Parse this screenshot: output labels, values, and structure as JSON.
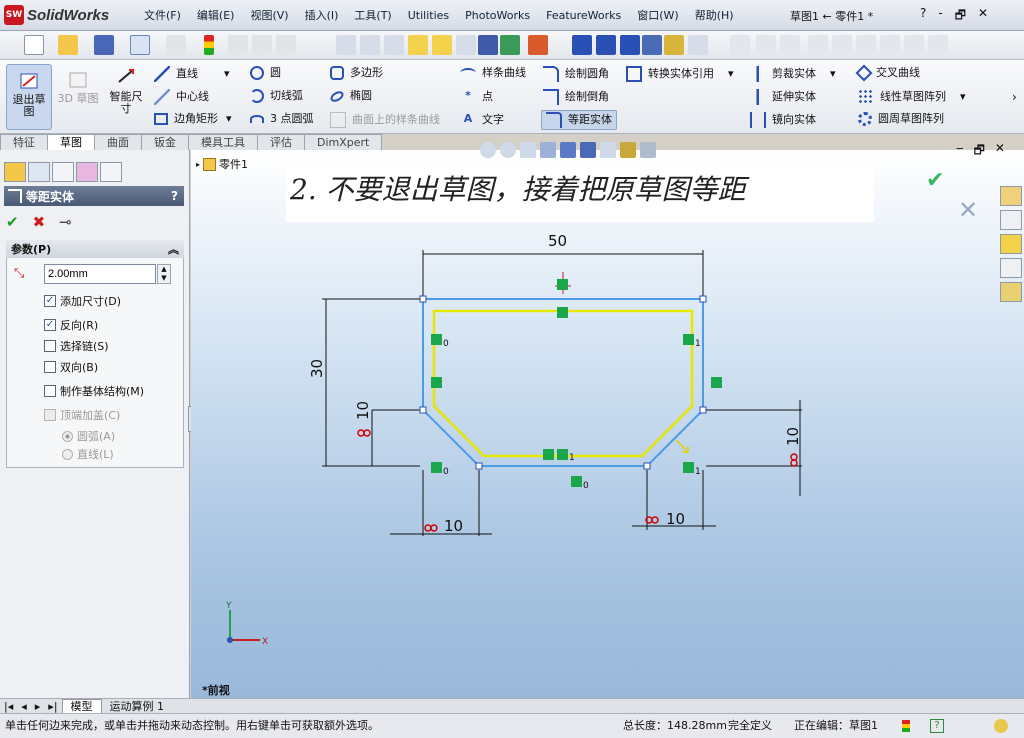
{
  "app": {
    "name": "SolidWorks",
    "logo_text": "SW"
  },
  "menu": [
    "文件(F)",
    "编辑(E)",
    "视图(V)",
    "插入(I)",
    "工具(T)",
    "Utilities",
    "PhotoWorks",
    "FeatureWorks",
    "窗口(W)",
    "帮助(H)"
  ],
  "doc_title": "草图1 ← 零件1 *",
  "title_ctrls": [
    "?",
    "-",
    "🗗",
    "✕"
  ],
  "command_manager": {
    "exit_sketch": "退出草图",
    "sketch_3d": "3D 草图",
    "smart_dim": "智能尺寸",
    "col1": [
      "直线",
      "中心线",
      "边角矩形"
    ],
    "col2": [
      "圆",
      "切线弧",
      "3 点圆弧"
    ],
    "col3": [
      "多边形",
      "椭圆",
      "曲面上的样条曲线"
    ],
    "col4": [
      "样条曲线",
      "点",
      "文字"
    ],
    "col5": [
      "绘制圆角",
      "绘制倒角",
      "等距实体"
    ],
    "convert": "转换实体引用",
    "col6": [
      "剪裁实体",
      "延伸实体",
      "镜向实体"
    ],
    "col7": [
      "交叉曲线",
      "线性草图阵列",
      "圆周草图阵列"
    ]
  },
  "tabs": [
    "特征",
    "草图",
    "曲面",
    "钣金",
    "模具工具",
    "评估",
    "DimXpert"
  ],
  "property_manager": {
    "title": "等距实体",
    "help": "?",
    "ok": "✔",
    "cancel": "✖",
    "pin": "⊸",
    "group_title": "参数(P)",
    "distance": "2.00mm",
    "options": [
      {
        "label": "添加尺寸(D)",
        "checked": true,
        "disabled": false
      },
      {
        "label": "反向(R)",
        "checked": true,
        "disabled": false
      },
      {
        "label": "选择链(S)",
        "checked": false,
        "disabled": false
      },
      {
        "label": "双向(B)",
        "checked": false,
        "disabled": false
      },
      {
        "label": "制作基体结构(M)",
        "checked": false,
        "disabled": false
      },
      {
        "label": "顶端加盖(C)",
        "checked": false,
        "disabled": true
      }
    ],
    "radios": [
      "圆弧(A)",
      "直线(L)"
    ]
  },
  "tree_root": "零件1",
  "banner": "2. 不要退出草图，接着把原草图等距",
  "sketch": {
    "dims": {
      "top": "50",
      "left": "30",
      "left_small": "10",
      "right_small": "10",
      "bottom_left": "10",
      "bottom_right": "10"
    },
    "rel_labels": {
      "a": "0",
      "b": "1",
      "c": "1",
      "d": "0",
      "e": "1",
      "f": "0"
    }
  },
  "triad": {
    "x": "X",
    "y": "Y"
  },
  "view_label": "*前视",
  "bottom_tabs": [
    "模型",
    "运动算例 1"
  ],
  "status": {
    "hint": "单击任何边来完成，或单击并拖动来动态控制。用右键单击可获取额外选项。",
    "length": "总长度：148.28mm",
    "state": "完全定义",
    "editing": "正在编辑：草图1"
  },
  "colors": {
    "accent": "#4a5a75",
    "sketch_yellow": "#e6e600",
    "sketch_blue": "#4d9be6",
    "dim_red": "#d00000",
    "relation_green": "#1aa64a"
  }
}
